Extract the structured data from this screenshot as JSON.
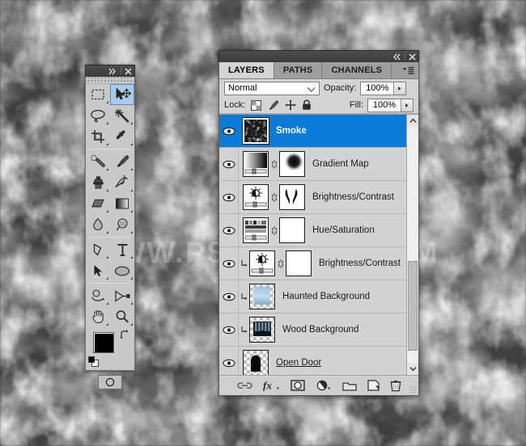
{
  "background": {
    "type": "smoke-texture",
    "base_color": "#4a4a4a",
    "watermark_text": "WWW.PSD-DUDE.COM"
  },
  "toolbar": {
    "name": "Tools",
    "collapse_icon": "double-chevron-right-icon",
    "close_icon": "close-icon",
    "selected_tool": "move-tool",
    "tools": [
      {
        "id": "rectangular-marquee-tool",
        "label": "Rectangular Marquee Tool",
        "has_flyout": true
      },
      {
        "id": "move-tool",
        "label": "Move Tool",
        "has_flyout": false,
        "selected": true
      },
      {
        "id": "lasso-tool",
        "label": "Lasso Tool",
        "has_flyout": true
      },
      {
        "id": "magic-wand-tool",
        "label": "Magic Wand Tool",
        "has_flyout": true
      },
      {
        "id": "crop-tool",
        "label": "Crop Tool",
        "has_flyout": true
      },
      {
        "id": "eyedropper-tool",
        "label": "Eyedropper Tool",
        "has_flyout": true
      },
      {
        "id": "healing-brush-tool",
        "label": "Spot Healing Brush Tool",
        "has_flyout": true
      },
      {
        "id": "brush-tool",
        "label": "Brush Tool",
        "has_flyout": true
      },
      {
        "id": "clone-stamp-tool",
        "label": "Clone Stamp Tool",
        "has_flyout": true
      },
      {
        "id": "history-brush-tool",
        "label": "History Brush Tool",
        "has_flyout": true
      },
      {
        "id": "eraser-tool",
        "label": "Eraser Tool",
        "has_flyout": true
      },
      {
        "id": "gradient-tool",
        "label": "Gradient Tool",
        "has_flyout": true
      },
      {
        "id": "blur-tool",
        "label": "Blur Tool",
        "has_flyout": true
      },
      {
        "id": "dodge-tool",
        "label": "Dodge Tool",
        "has_flyout": true
      },
      {
        "id": "pen-tool",
        "label": "Pen Tool",
        "has_flyout": true
      },
      {
        "id": "horizontal-type-tool",
        "label": "Horizontal Type Tool",
        "has_flyout": true
      },
      {
        "id": "path-selection-tool",
        "label": "Path Selection Tool",
        "has_flyout": true
      },
      {
        "id": "ellipse-tool",
        "label": "Ellipse Tool",
        "has_flyout": true
      },
      {
        "id": "3d-object-rotate-tool",
        "label": "3D Object Rotate Tool",
        "has_flyout": true
      },
      {
        "id": "3d-camera-rotate-tool",
        "label": "3D Camera Rotate Tool",
        "has_flyout": true
      },
      {
        "id": "hand-tool",
        "label": "Hand Tool",
        "has_flyout": true
      },
      {
        "id": "zoom-tool",
        "label": "Zoom Tool",
        "has_flyout": true
      }
    ],
    "colors": {
      "foreground": "#000000",
      "background": "#ffffff",
      "swap_icon": "swap-colors-icon",
      "default_icon": "default-colors-icon"
    },
    "quick_mask": {
      "icon": "quick-mask-icon",
      "label": "Edit in Quick Mask Mode"
    }
  },
  "layers_panel": {
    "collapse_icon": "double-chevron-left-icon",
    "close_icon": "close-icon",
    "menu_icon": "panel-menu-icon",
    "tabs": [
      {
        "label": "LAYERS",
        "active": true
      },
      {
        "label": "PATHS",
        "active": false
      },
      {
        "label": "CHANNELS",
        "active": false
      }
    ],
    "blend_mode": "Normal",
    "opacity_label": "Opacity:",
    "opacity_value": "100%",
    "fill_label": "Fill:",
    "fill_value": "100%",
    "lock_label": "Lock:",
    "lock_icons": [
      {
        "id": "lock-transparent-pixels-icon",
        "label": "Lock transparent pixels"
      },
      {
        "id": "lock-image-pixels-icon",
        "label": "Lock image pixels"
      },
      {
        "id": "lock-position-icon",
        "label": "Lock position"
      },
      {
        "id": "lock-all-icon",
        "label": "Lock all"
      }
    ],
    "selection_color": "#0b7bd8",
    "layers": [
      {
        "name": "Smoke",
        "visible": true,
        "selected": true,
        "kind": "raster",
        "thumb": "smoke-texture",
        "clipped": false,
        "has_mask": false,
        "underline": false
      },
      {
        "name": "Gradient Map",
        "visible": true,
        "selected": false,
        "kind": "adjustment-gradient-map",
        "thumb": "gradient-map-icon",
        "clipped": false,
        "has_mask": true,
        "mask": "radial-blob-mask",
        "underline": false
      },
      {
        "name": "Brightness/Contrast",
        "visible": true,
        "selected": false,
        "kind": "adjustment-brightness-contrast",
        "thumb": "brightness-contrast-icon",
        "clipped": false,
        "has_mask": true,
        "mask": "brush-strokes-mask",
        "underline": false
      },
      {
        "name": "Hue/Saturation",
        "visible": true,
        "selected": false,
        "kind": "adjustment-hue-saturation",
        "thumb": "hue-saturation-icon",
        "clipped": false,
        "has_mask": true,
        "mask": "white-mask",
        "underline": false
      },
      {
        "name": "Brightness/Contrast",
        "visible": true,
        "selected": false,
        "kind": "adjustment-brightness-contrast",
        "thumb": "brightness-contrast-icon",
        "clipped": true,
        "has_mask": true,
        "mask": "white-mask",
        "underline": false
      },
      {
        "name": "Haunted Background",
        "visible": true,
        "selected": false,
        "kind": "raster",
        "thumb": "haunted-sky-thumb",
        "clipped": true,
        "has_mask": false,
        "underline": false
      },
      {
        "name": "Wood Background",
        "visible": true,
        "selected": false,
        "kind": "raster",
        "thumb": "wood-forest-thumb",
        "clipped": true,
        "has_mask": false,
        "underline": false
      },
      {
        "name": "Open Door",
        "visible": true,
        "selected": false,
        "kind": "raster",
        "thumb": "open-door-thumb",
        "clipped": false,
        "has_mask": false,
        "underline": true
      },
      {
        "name": "",
        "visible": true,
        "selected": false,
        "kind": "raster",
        "thumb": "dark-room-thumb",
        "clipped": false,
        "has_mask": false,
        "underline": false,
        "partial": true
      }
    ],
    "scrollbar": {
      "up_icon": "chevron-up-icon",
      "down_icon": "chevron-down-icon",
      "thumb_position": "near-bottom"
    },
    "bottom_buttons": [
      {
        "id": "link-layers-button",
        "label": "Link layers",
        "icon": "link-icon"
      },
      {
        "id": "layer-style-button",
        "label": "Add a layer style",
        "icon": "fx-icon"
      },
      {
        "id": "add-layer-mask-button",
        "label": "Add layer mask",
        "icon": "mask-icon"
      },
      {
        "id": "new-adjustment-layer-button",
        "label": "Create new fill or adjustment layer",
        "icon": "half-circle-icon"
      },
      {
        "id": "new-group-button",
        "label": "Create a new group",
        "icon": "folder-icon"
      },
      {
        "id": "new-layer-button",
        "label": "Create a new layer",
        "icon": "new-layer-icon"
      },
      {
        "id": "delete-layer-button",
        "label": "Delete layer",
        "icon": "trash-icon"
      }
    ]
  }
}
